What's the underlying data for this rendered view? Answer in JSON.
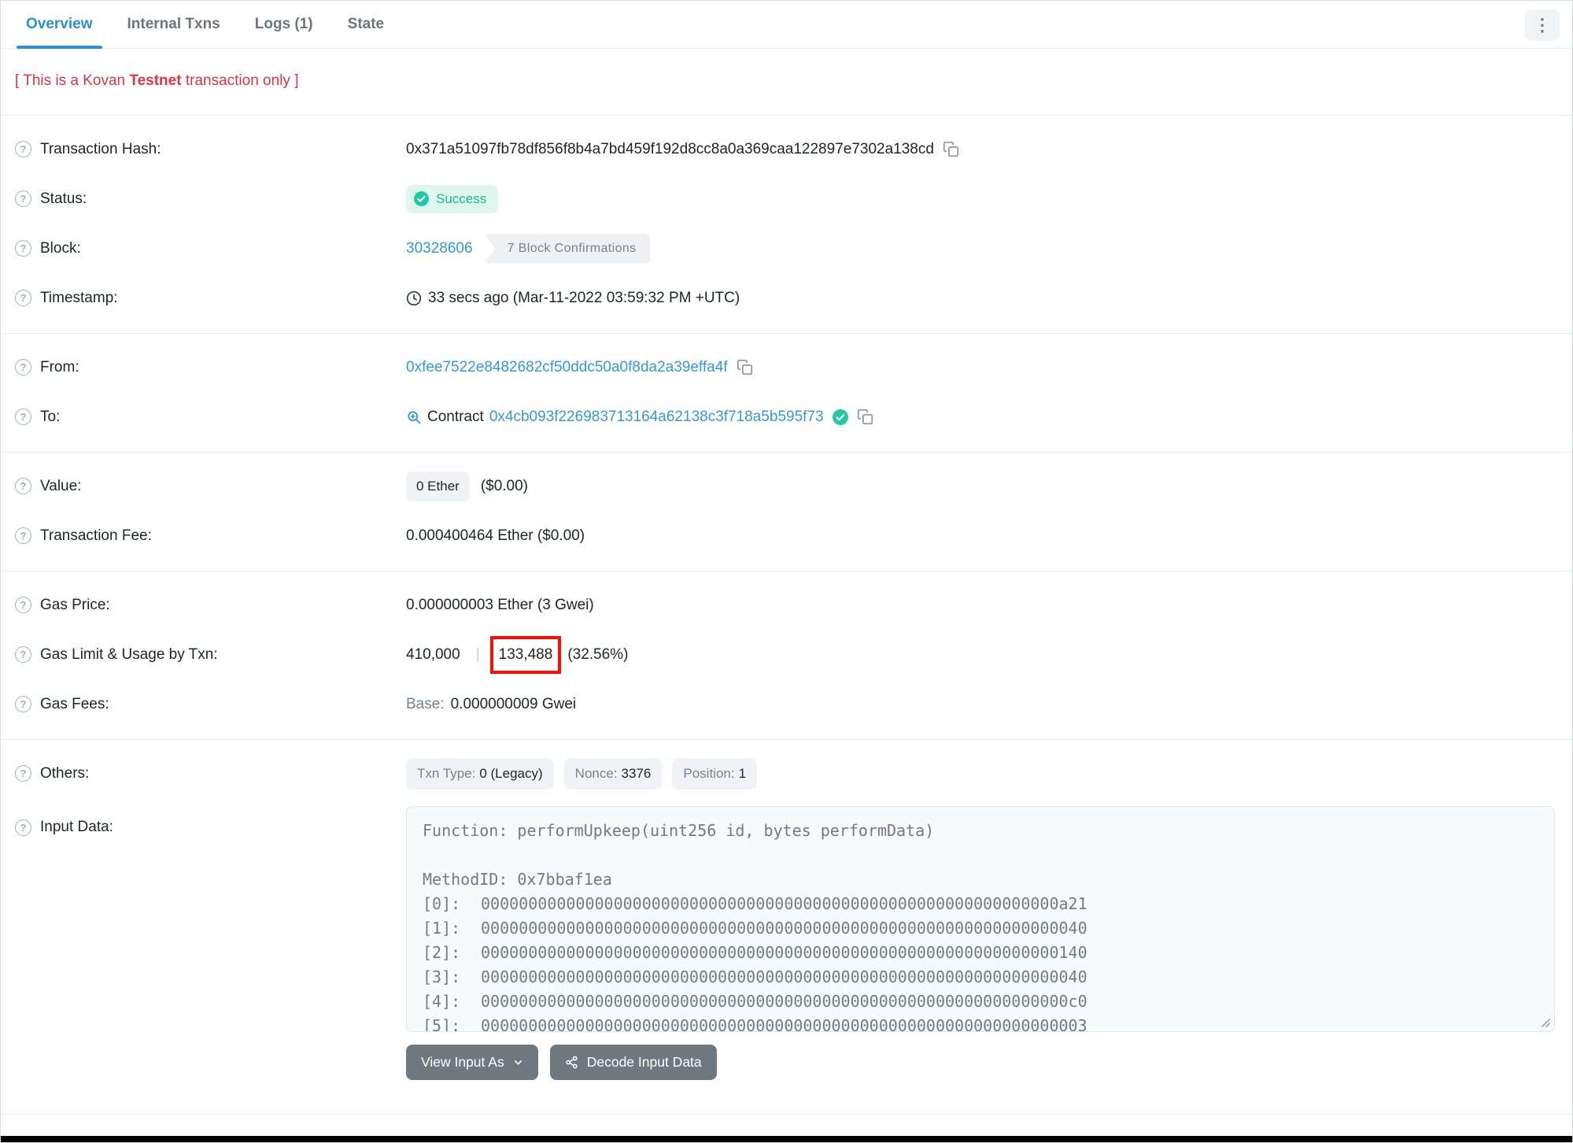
{
  "header": {
    "tabs": [
      {
        "label": "Overview"
      },
      {
        "label": "Internal Txns"
      },
      {
        "label": "Logs (1)"
      },
      {
        "label": "State"
      }
    ],
    "kebab_glyph": "⋮"
  },
  "notice": {
    "prefix": "[ This is a Kovan ",
    "bold": "Testnet",
    "suffix": " transaction only ]"
  },
  "icons": {
    "help": "?",
    "names": [
      "help-icon",
      "kebab-menu-icon",
      "check-circle-icon",
      "copy-icon",
      "clock-icon",
      "magnifier-icon",
      "chevron-down-icon",
      "decode-nodes-icon",
      "resize-handle-icon"
    ]
  },
  "fields": {
    "hash": {
      "label": "Transaction Hash:",
      "value": "0x371a51097fb78df856f8b4a7bd459f192d8cc8a0a369caa122897e7302a138cd"
    },
    "status": {
      "label": "Status:",
      "badge": "Success"
    },
    "block": {
      "label": "Block:",
      "number": "30328606",
      "confirmations": "7 Block Confirmations"
    },
    "timestamp": {
      "label": "Timestamp:",
      "value": "33 secs ago (Mar-11-2022 03:59:32 PM +UTC)"
    },
    "from": {
      "label": "From:",
      "address": "0xfee7522e8482682cf50ddc50a0f8da2a39effa4f"
    },
    "to": {
      "label": "To:",
      "type": "Contract",
      "address": "0x4cb093f226983713164a62138c3f718a5b595f73"
    },
    "value": {
      "label": "Value:",
      "amount": "0 Ether",
      "usd": "($0.00)"
    },
    "fee": {
      "label": "Transaction Fee:",
      "value": "0.000400464 Ether ($0.00)"
    },
    "gas_price": {
      "label": "Gas Price:",
      "value": "0.000000003 Ether (3 Gwei)"
    },
    "gas_limit": {
      "label": "Gas Limit & Usage by Txn:",
      "limit": "410,000",
      "separator": "|",
      "used": "133,488",
      "percent": "(32.56%)"
    },
    "gas_fees": {
      "label": "Gas Fees:",
      "base_label": "Base:",
      "base_value": "0.000000009 Gwei"
    },
    "others": {
      "label": "Others:",
      "badges": [
        {
          "name": "Txn Type:",
          "value": "0 (Legacy)"
        },
        {
          "name": "Nonce:",
          "value": "3376"
        },
        {
          "name": "Position:",
          "value": "1"
        }
      ]
    },
    "input_data": {
      "label": "Input Data:",
      "function_line": "Function: performUpkeep(uint256 id, bytes performData)",
      "method_line": "MethodID: 0x7bbaf1ea",
      "words": [
        {
          "index": "[0]:",
          "hex": "0000000000000000000000000000000000000000000000000000000000000a21"
        },
        {
          "index": "[1]:",
          "hex": "0000000000000000000000000000000000000000000000000000000000000040"
        },
        {
          "index": "[2]:",
          "hex": "0000000000000000000000000000000000000000000000000000000000000140"
        },
        {
          "index": "[3]:",
          "hex": "0000000000000000000000000000000000000000000000000000000000000040"
        },
        {
          "index": "[4]:",
          "hex": "00000000000000000000000000000000000000000000000000000000000000c0"
        },
        {
          "index": "[5]:",
          "hex": "0000000000000000000000000000000000000000000000000000000000000003"
        }
      ]
    }
  },
  "actions": {
    "view_input_as": "View Input As",
    "decode": "Decode Input Data"
  },
  "colors": {
    "link": "#3498db",
    "active_tab": "#2f8fd6",
    "success_text": "#18b795",
    "success_bg": "#def6ee",
    "check_circle": "#23c9a3",
    "notice_red": "#dc3545",
    "annotation_box": "#ff0d00",
    "button_bg": "#6e7881",
    "badge_bg": "#f1f2f5",
    "muted_text": "#77838f"
  }
}
